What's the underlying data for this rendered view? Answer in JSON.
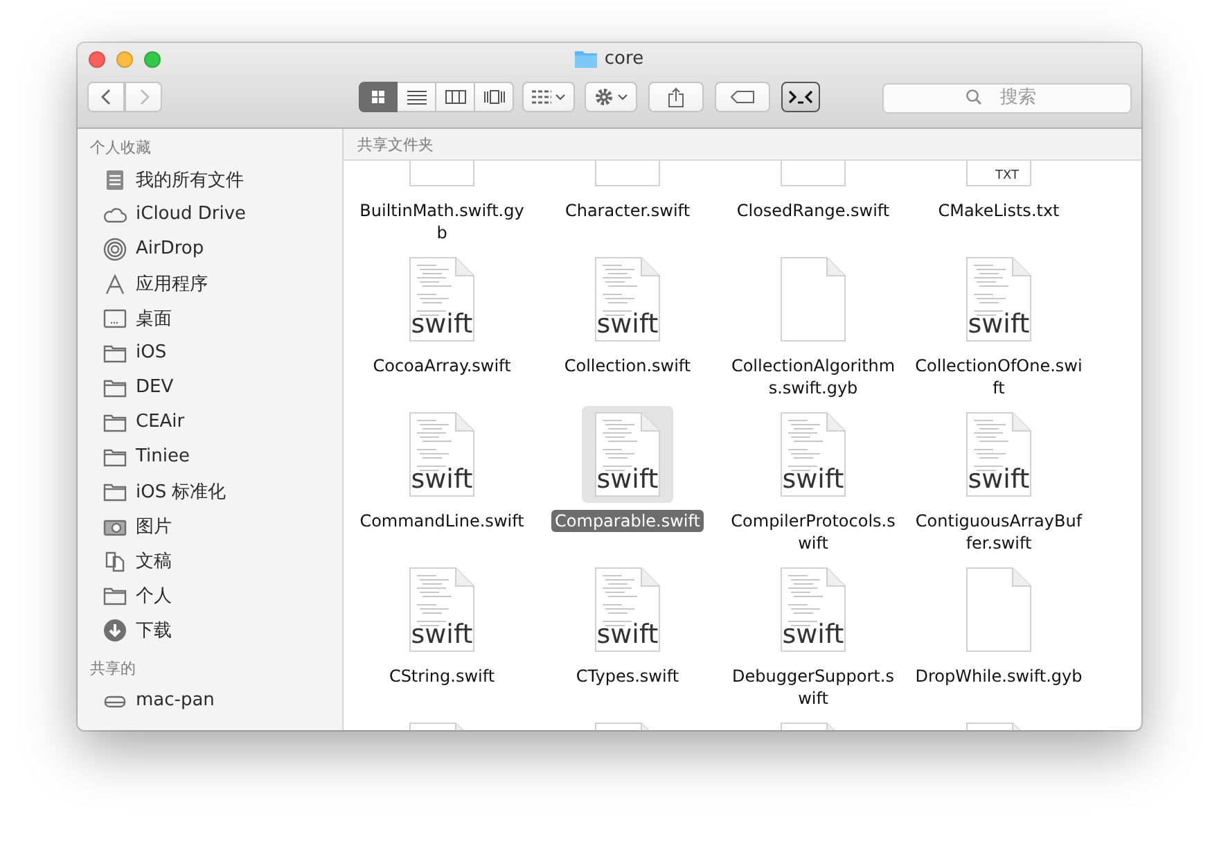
{
  "window": {
    "title": "core"
  },
  "toolbar": {
    "views": [
      {
        "kind": "icons",
        "selected": true
      },
      {
        "kind": "list",
        "selected": false
      },
      {
        "kind": "columns",
        "selected": false
      },
      {
        "kind": "coverflow",
        "selected": false
      }
    ],
    "search": {
      "placeholder": "搜索"
    }
  },
  "sidebar": {
    "sections": [
      {
        "title": "个人收藏",
        "items": [
          {
            "label": "我的所有文件",
            "kind": "allfiles"
          },
          {
            "label": "iCloud Drive",
            "kind": "cloud"
          },
          {
            "label": "AirDrop",
            "kind": "airdrop"
          },
          {
            "label": "应用程序",
            "kind": "apps"
          },
          {
            "label": "桌面",
            "kind": "desktop"
          },
          {
            "label": "iOS",
            "kind": "folder"
          },
          {
            "label": "DEV",
            "kind": "folder"
          },
          {
            "label": "CEAir",
            "kind": "folder"
          },
          {
            "label": "Tiniee",
            "kind": "folder"
          },
          {
            "label": "iOS 标准化",
            "kind": "folder"
          },
          {
            "label": "图片",
            "kind": "camera"
          },
          {
            "label": "文稿",
            "kind": "docs"
          },
          {
            "label": "个人",
            "kind": "folder"
          },
          {
            "label": "下载",
            "kind": "download"
          }
        ]
      },
      {
        "title": "共享的",
        "items": [
          {
            "label": "mac-pan",
            "kind": "drive"
          }
        ]
      }
    ]
  },
  "content": {
    "path_bar": "共享文件夹",
    "files": [
      {
        "name": "BuiltinMath.swift.gyb",
        "kind": "blank",
        "selected": false
      },
      {
        "name": "Character.swift",
        "kind": "swift",
        "selected": false
      },
      {
        "name": "ClosedRange.swift",
        "kind": "swift",
        "selected": false
      },
      {
        "name": "CMakeLists.txt",
        "kind": "txt",
        "icon_label": "TXT",
        "selected": false
      },
      {
        "name": "CocoaArray.swift",
        "kind": "swift",
        "icon_label": "swift",
        "selected": false
      },
      {
        "name": "Collection.swift",
        "kind": "swift",
        "icon_label": "swift",
        "selected": false
      },
      {
        "name": "CollectionAlgorithms.swift.gyb",
        "kind": "blank",
        "selected": false
      },
      {
        "name": "CollectionOfOne.swift",
        "kind": "swift",
        "icon_label": "swift",
        "selected": false
      },
      {
        "name": "CommandLine.swift",
        "kind": "swift",
        "icon_label": "swift",
        "selected": false
      },
      {
        "name": "Comparable.swift",
        "kind": "swift",
        "icon_label": "swift",
        "selected": true
      },
      {
        "name": "CompilerProtocols.swift",
        "kind": "swift",
        "icon_label": "swift",
        "selected": false
      },
      {
        "name": "ContiguousArrayBuffer.swift",
        "kind": "swift",
        "icon_label": "swift",
        "selected": false
      },
      {
        "name": "CString.swift",
        "kind": "swift",
        "icon_label": "swift",
        "selected": false
      },
      {
        "name": "CTypes.swift",
        "kind": "swift",
        "icon_label": "swift",
        "selected": false
      },
      {
        "name": "DebuggerSupport.swift",
        "kind": "swift",
        "icon_label": "swift",
        "selected": false
      },
      {
        "name": "DropWhile.swift.gyb",
        "kind": "blank",
        "selected": false
      },
      {
        "kind": "swift",
        "selected": false
      },
      {
        "kind": "swift",
        "selected": false
      },
      {
        "kind": "swift",
        "selected": false
      },
      {
        "kind": "swift",
        "selected": false
      }
    ]
  }
}
